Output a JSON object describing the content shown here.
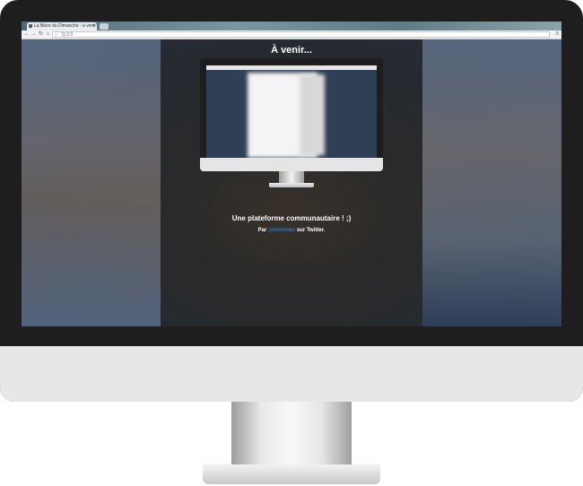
{
  "browser": {
    "tab_title": "La Bière du Dimanche - à venir",
    "tab_close": "×",
    "url_text": "Q  2  0",
    "nav": {
      "back": "←",
      "forward": "→",
      "reload": "↻",
      "home": "⌂"
    },
    "menu_icon": "≡",
    "search_icon": "search-icon"
  },
  "page": {
    "title": "À venir...",
    "tagline": "Une plateforme communautaire ! ;)",
    "byline_prefix": "Par ",
    "byline_handle": "@NomDev",
    "byline_suffix": " sur Twitter."
  },
  "colors": {
    "bezel": "#1e1e1e",
    "chin": "#e6e7e6",
    "link": "#2f79c8"
  }
}
